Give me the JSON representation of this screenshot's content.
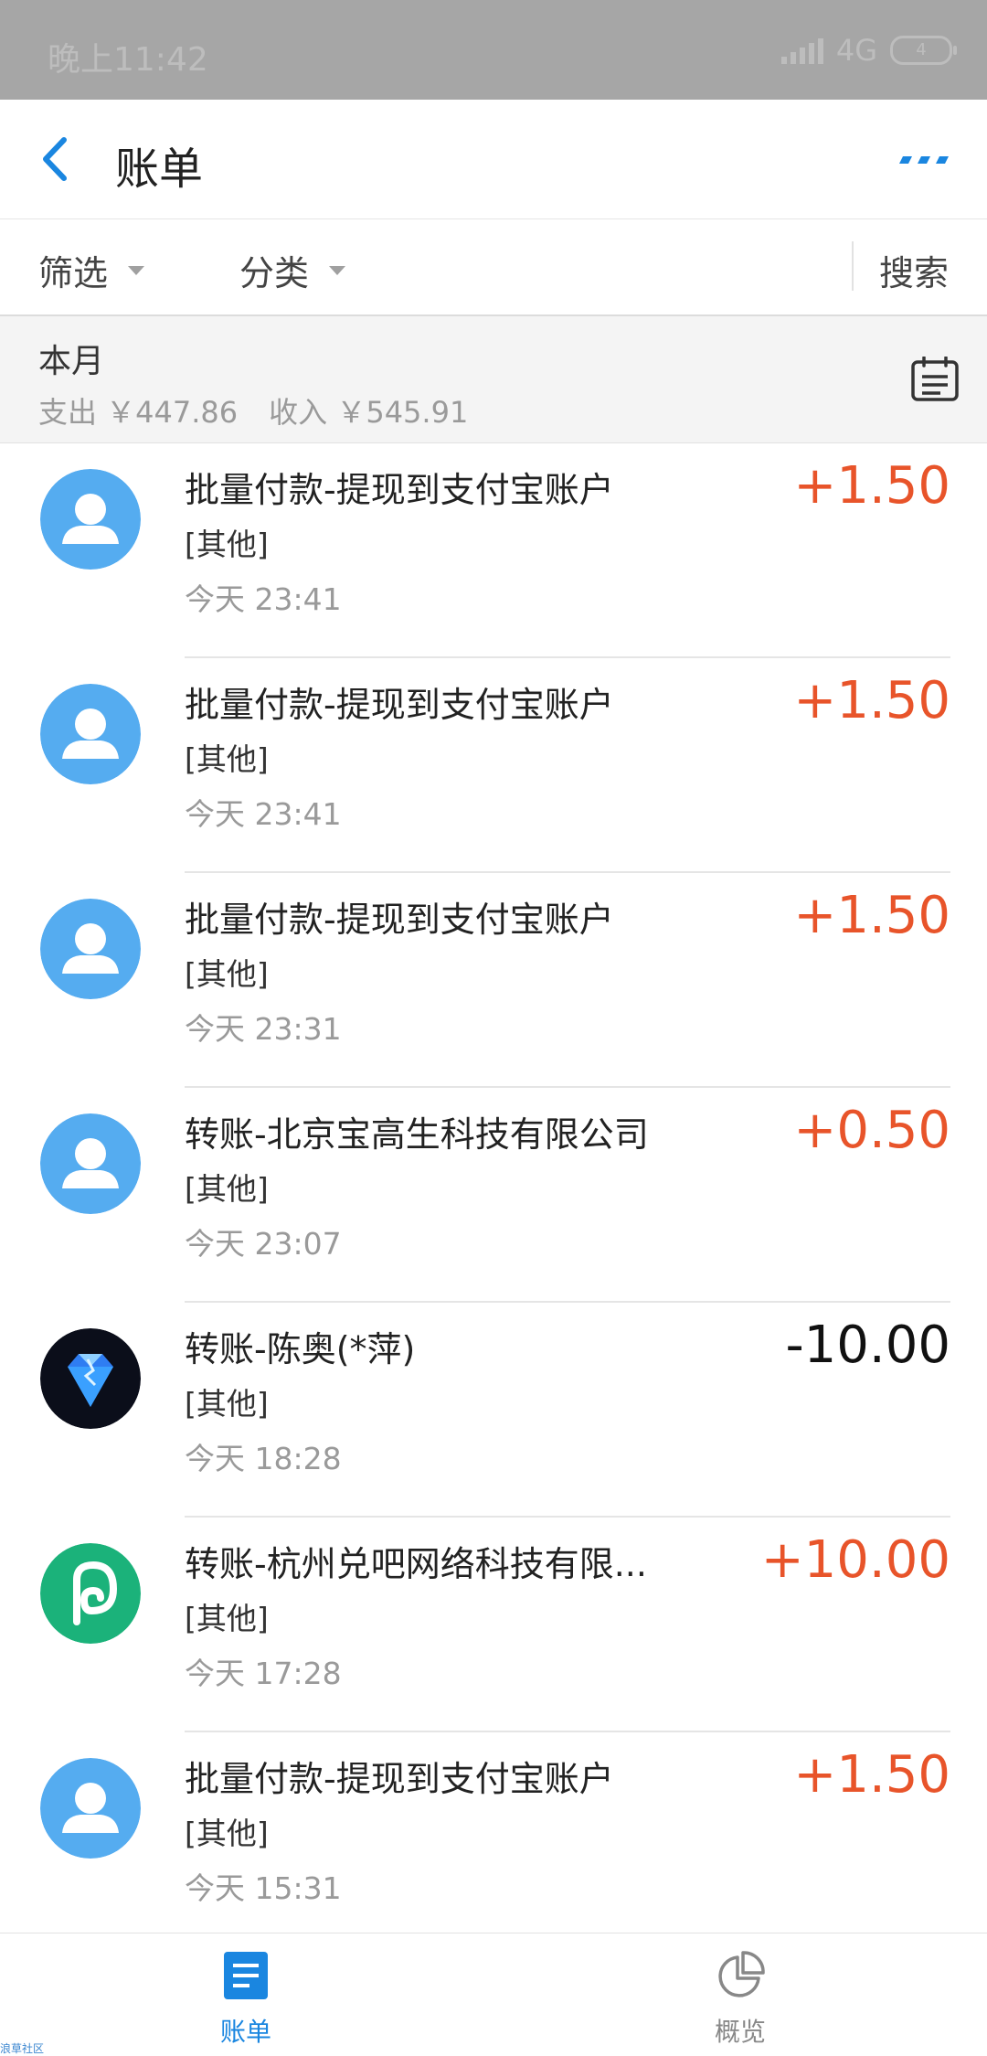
{
  "status_bar": {
    "time": "晚上11:42",
    "network": "4G",
    "battery": "4"
  },
  "header": {
    "title": "账单"
  },
  "filters": {
    "filter_label": "筛选",
    "category_label": "分类",
    "search_label": "搜索"
  },
  "month": {
    "label": "本月",
    "expense": "支出 ￥447.86",
    "income": "收入 ￥545.91"
  },
  "transactions": [
    {
      "name": "批量付款-提现到支付宝账户",
      "category": "[其他]",
      "time": "今天  23:41",
      "amount": "+1.50",
      "direction": "income",
      "avatar": "default-user"
    },
    {
      "name": "批量付款-提现到支付宝账户",
      "category": "[其他]",
      "time": "今天  23:41",
      "amount": "+1.50",
      "direction": "income",
      "avatar": "default-user"
    },
    {
      "name": "批量付款-提现到支付宝账户",
      "category": "[其他]",
      "time": "今天  23:31",
      "amount": "+1.50",
      "direction": "income",
      "avatar": "default-user"
    },
    {
      "name": "转账-北京宝高生科技有限公司",
      "category": "[其他]",
      "time": "今天  23:07",
      "amount": "+0.50",
      "direction": "income",
      "avatar": "default-user"
    },
    {
      "name": "转账-陈奥(*萍)",
      "category": "[其他]",
      "time": "今天  18:28",
      "amount": "-10.00",
      "direction": "expense",
      "avatar": "diamond"
    },
    {
      "name": "转账-杭州兑吧网络科技有限...",
      "category": "[其他]",
      "time": "今天  17:28",
      "amount": "+10.00",
      "direction": "income",
      "avatar": "green-logo"
    },
    {
      "name": "批量付款-提现到支付宝账户",
      "category": "[其他]",
      "time": "今天  15:31",
      "amount": "+1.50",
      "direction": "income",
      "avatar": "default-user"
    }
  ],
  "bottom_nav": {
    "bills_label": "账单",
    "overview_label": "概览"
  },
  "watermark": "浪草社区",
  "colors": {
    "accent": "#1a86e0",
    "income": "#e8542a",
    "expense": "#111111",
    "avatar_blue": "#55acf0"
  }
}
